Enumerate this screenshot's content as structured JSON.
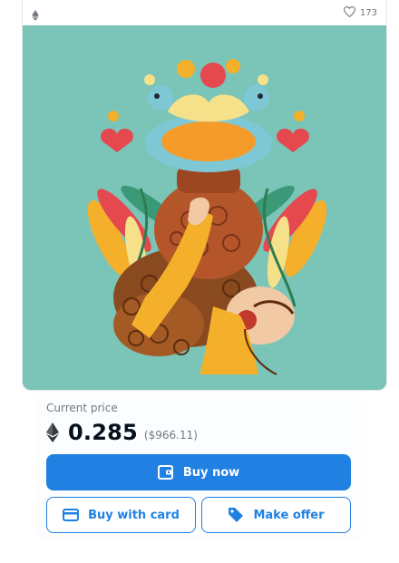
{
  "item": {
    "favorites_count": "173",
    "image_alt": "Illustrated woman carrying a clay pot with birds and flowers"
  },
  "price": {
    "label": "Current price",
    "eth_value": "0.285",
    "usd_value": "($966.11)",
    "currency_icon": "ethereum-icon"
  },
  "actions": {
    "buy_now": "Buy now",
    "buy_with_card": "Buy with card",
    "make_offer": "Make offer"
  },
  "colors": {
    "accent": "#2081e2",
    "artwork_background": "#7ac4b8"
  }
}
